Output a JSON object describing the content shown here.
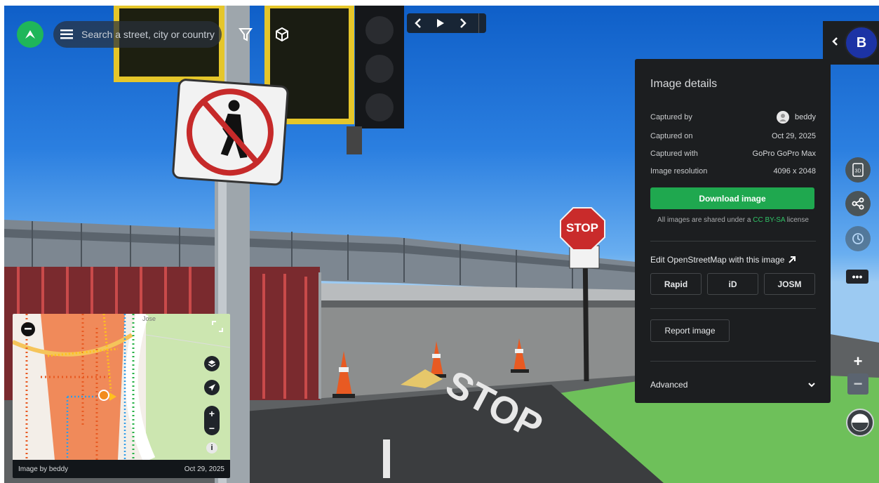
{
  "header": {
    "search_placeholder": "Search a street, city or country",
    "seq_prev": "‹",
    "seq_play": "▶",
    "seq_next": "›"
  },
  "user": {
    "initial": "B"
  },
  "scene": {
    "stop_sign": "STOP",
    "road_marking": "STOP"
  },
  "details": {
    "title": "Image details",
    "rows": [
      {
        "label": "Captured by",
        "value": "beddy"
      },
      {
        "label": "Captured on",
        "value": "Oct 29, 2025"
      },
      {
        "label": "Captured with",
        "value": "GoPro GoPro Max"
      },
      {
        "label": "Image resolution",
        "value": "4096 x 2048"
      }
    ],
    "download_label": "Download image",
    "license_prefix": "All images are shared under a",
    "license_link": "CC BY-SA",
    "license_suffix": "license",
    "edit_title": "Edit OpenStreetMap with this image",
    "editors": [
      "Rapid",
      "iD",
      "JOSM"
    ],
    "report_label": "Report image",
    "advanced_label": "Advanced"
  },
  "controls": {
    "view3d": "3D",
    "more": "•••",
    "zoom_in": "+",
    "zoom_out": "−"
  },
  "minimap": {
    "image_by": "Image by beddy",
    "date": "Oct 29, 2025",
    "zoom_in": "+",
    "zoom_out": "−",
    "info": "i",
    "street_label": "Jose"
  }
}
